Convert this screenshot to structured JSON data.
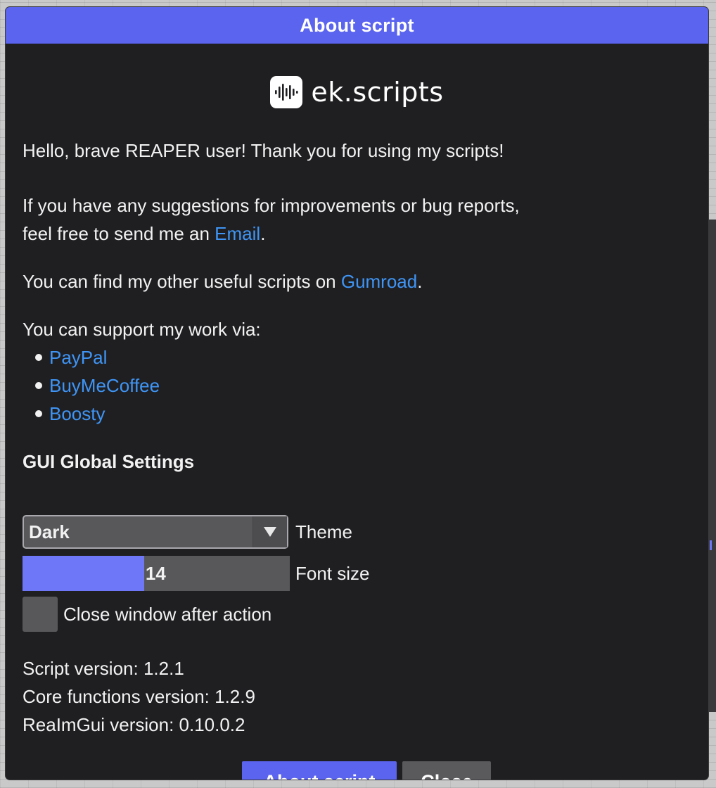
{
  "window": {
    "title": "About script"
  },
  "logo": {
    "text": "ek.scripts"
  },
  "intro": {
    "greeting": "Hello, brave REAPER user! Thank you for using my scripts!",
    "feedback_line1": "If you have any suggestions for improvements or bug reports,",
    "feedback_line2_prefix": "feel free to send me an ",
    "email_link": "Email",
    "feedback_line2_suffix": ".",
    "scripts_prefix": "You can find my other useful scripts on ",
    "gumroad_link": "Gumroad",
    "scripts_suffix": ".",
    "support_intro": "You can support my work via:",
    "support_links": [
      "PayPal",
      "BuyMeCoffee",
      "Boosty"
    ]
  },
  "settings": {
    "title": "GUI Global Settings",
    "theme": {
      "selected": "Dark",
      "label": "Theme"
    },
    "font_size": {
      "value": "14",
      "fill_fraction": 0.455,
      "label": "Font size"
    },
    "close_after_action": {
      "checked": false,
      "label": "Close window after action"
    }
  },
  "versions": {
    "script": "Script version: 1.2.1",
    "core": "Core functions version: 1.2.9",
    "realmgui": "ReaImGui version: 0.10.0.2"
  },
  "buttons": {
    "about": "About script",
    "close": "Close"
  },
  "colors": {
    "accent": "#5b64ef",
    "slider_fill": "#6e77f8",
    "link": "#3f95f5",
    "window_bg": "#1f1f22",
    "control_bg": "#58585b"
  },
  "icons": {
    "logo": "waveform-icon",
    "combo": "triangle-down-icon"
  }
}
